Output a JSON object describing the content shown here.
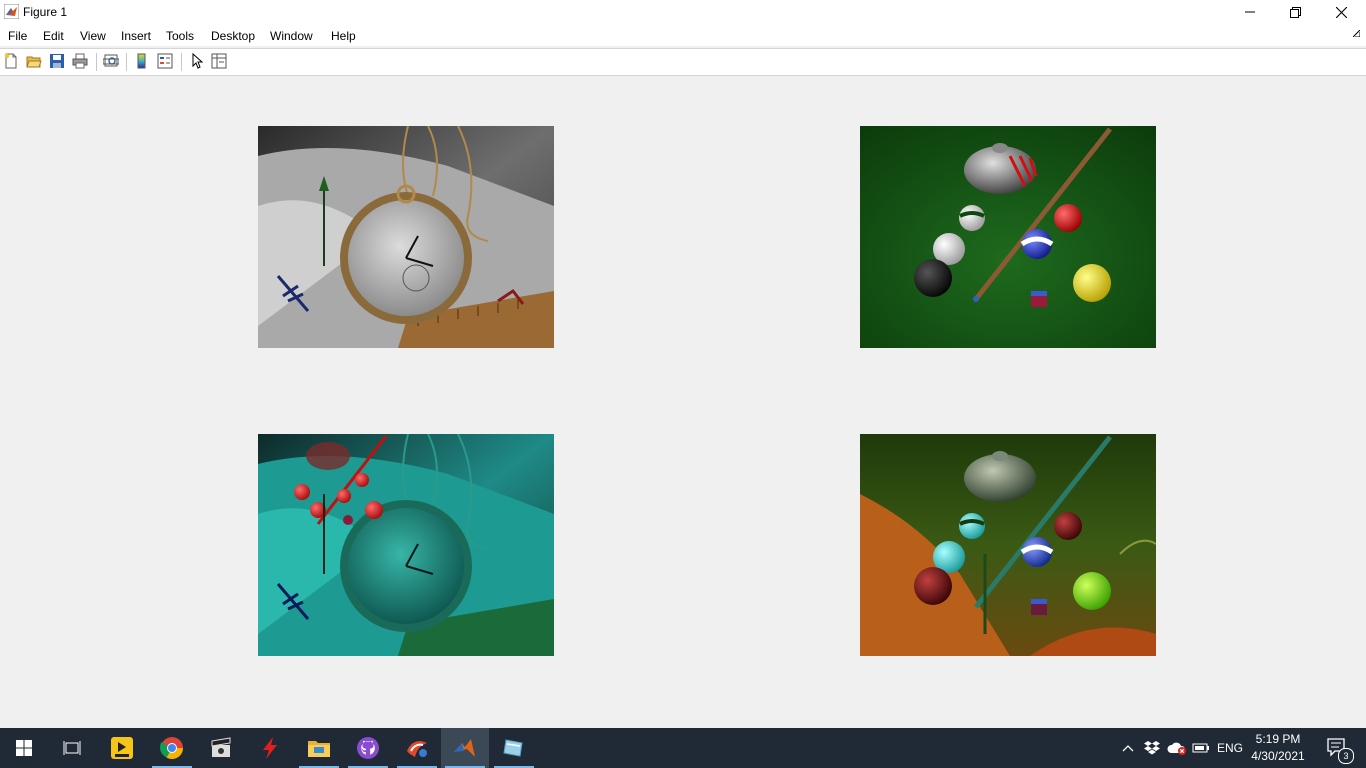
{
  "window": {
    "title": "Figure 1",
    "controls": [
      "minimize",
      "maximize",
      "close"
    ]
  },
  "menu": {
    "items": [
      {
        "label": "File"
      },
      {
        "label": "Edit"
      },
      {
        "label": "View"
      },
      {
        "label": "Insert"
      },
      {
        "label": "Tools"
      },
      {
        "label": "Desktop"
      },
      {
        "label": "Window"
      },
      {
        "label": "Help"
      }
    ]
  },
  "toolbar": {
    "icons": [
      "new-figure-icon",
      "open-file-icon",
      "save-icon",
      "print-icon",
      "print-preview-icon",
      "colorbar-icon",
      "legend-icon",
      "edit-plot-arrow-icon",
      "property-inspector-icon"
    ]
  },
  "figure": {
    "images": [
      {
        "name": "pocket-watch-original"
      },
      {
        "name": "pool-balls-original"
      },
      {
        "name": "pocket-watch-blended-cyan"
      },
      {
        "name": "pool-balls-blended-orange"
      }
    ]
  },
  "taskbar": {
    "apps": [
      "start-icon",
      "task-view-icon",
      "potplayer-icon",
      "chrome-icon",
      "video-editor-icon",
      "flash-icon",
      "file-explorer-icon",
      "github-desktop-icon",
      "app-icon",
      "matlab-icon",
      "window-app-icon"
    ],
    "language": "ENG",
    "time": "5:19 PM",
    "date": "4/30/2021",
    "notification_count": "3"
  },
  "colors": {
    "taskbar": "#1f2a36",
    "accent": "#76b9ed"
  }
}
